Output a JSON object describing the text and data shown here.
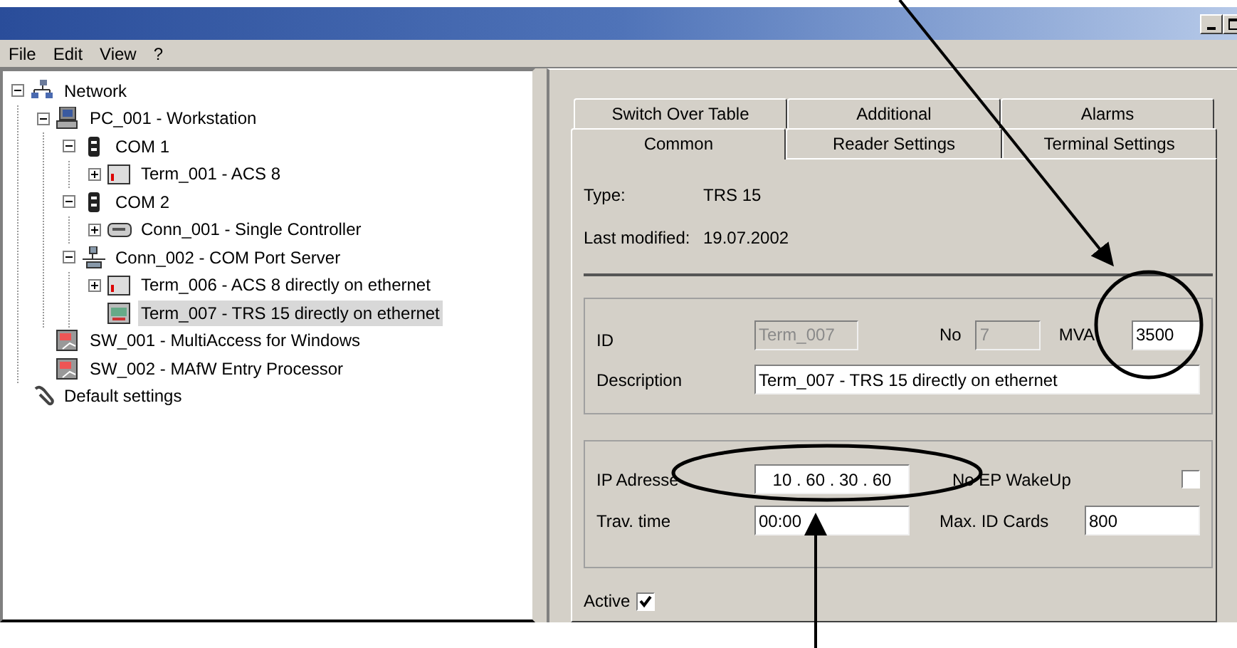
{
  "menu": [
    {
      "label": "File"
    },
    {
      "label": "Edit"
    },
    {
      "label": "View"
    },
    {
      "label": "?"
    }
  ],
  "tree": [
    {
      "label": "Network",
      "kind": "network",
      "expanded": true,
      "selected": false,
      "children": [
        {
          "label": "PC_001 - Workstation",
          "kind": "pc",
          "expanded": true,
          "selected": false,
          "children": [
            {
              "label": "COM 1",
              "kind": "port",
              "expanded": true,
              "selected": false,
              "children": [
                {
                  "label": "Term_001 - ACS 8",
                  "kind": "terminal",
                  "expanded": false,
                  "selected": false
                }
              ]
            },
            {
              "label": "COM 2",
              "kind": "port",
              "expanded": true,
              "selected": false,
              "children": [
                {
                  "label": "Conn_001 - Single Controller",
                  "kind": "controller",
                  "expanded": false,
                  "selected": false
                }
              ]
            },
            {
              "label": "Conn_002 - COM Port Server",
              "kind": "server",
              "expanded": true,
              "selected": false,
              "children": [
                {
                  "label": "Term_006 - ACS 8 directly on ethernet",
                  "kind": "terminal",
                  "expanded": false,
                  "selected": false
                },
                {
                  "label": "Term_007 - TRS 15 directly on ethernet",
                  "kind": "reader",
                  "selected": true
                }
              ]
            }
          ]
        },
        {
          "label": "SW_001 - MultiAccess for Windows",
          "kind": "software",
          "selected": false
        },
        {
          "label": "SW_002 - MAfW Entry Processor",
          "kind": "software",
          "selected": false
        }
      ]
    },
    {
      "label": "Default settings",
      "kind": "settings",
      "selected": false
    }
  ],
  "tab_rows": [
    {
      "tabs": [
        {
          "label": "Switch Over Table",
          "selected": false
        },
        {
          "label": "Additional",
          "selected": false
        },
        {
          "label": "Alarms",
          "selected": false
        }
      ]
    },
    {
      "tabs": [
        {
          "label": "Common",
          "selected": true
        },
        {
          "label": "Reader Settings",
          "selected": false
        },
        {
          "label": "Terminal Settings",
          "selected": false
        }
      ]
    }
  ],
  "info": [
    {
      "label": "Type:",
      "value": "TRS 15"
    },
    {
      "label": "Last modified:",
      "value": "19.07.2002"
    }
  ],
  "identity": {
    "id": {
      "label": "ID",
      "value": "Term_007",
      "disabled": true
    },
    "no": {
      "label": "No",
      "value": "7",
      "disabled": true
    },
    "mva": {
      "label": "MVA",
      "value": "3500",
      "disabled": false
    },
    "description": {
      "label": "Description",
      "value": "Term_007 - TRS 15 directly on ethernet",
      "disabled": false
    }
  },
  "connection": {
    "ip": {
      "label": "IP Adresse",
      "value": "10 . 60 . 30 . 60"
    },
    "wakeup": {
      "label": "No EP WakeUp",
      "checked": false
    },
    "trav_time": {
      "label": "Trav. time",
      "value": "00:00"
    },
    "max_cards": {
      "label": "Max. ID Cards",
      "value": "800"
    }
  },
  "active": {
    "label": "Active",
    "checked": true
  }
}
